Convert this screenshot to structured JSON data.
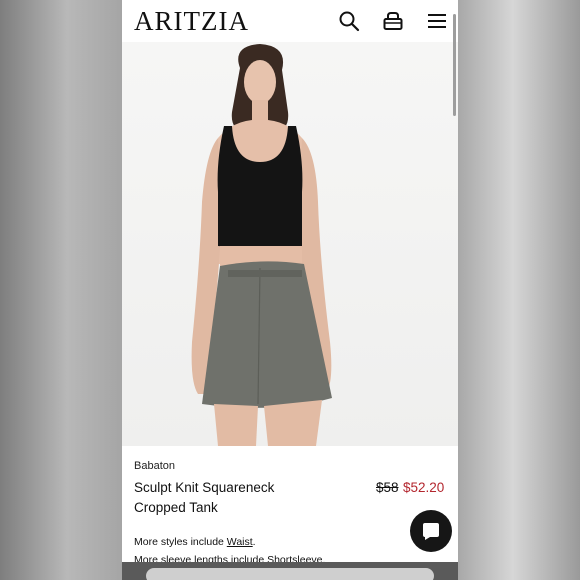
{
  "header": {
    "logo": "ARITZIA",
    "icons": [
      "search-icon",
      "bag-icon",
      "menu-icon"
    ]
  },
  "product": {
    "brand": "Babaton",
    "name": "Sculpt Knit Squareneck Cropped Tank",
    "original_price": "$58",
    "sale_price": "$52.20",
    "more_styles_prefix": "More styles include ",
    "more_styles_link": "Waist",
    "more_styles_suffix": ".",
    "more_sleeves": "More sleeve lengths include Shortsleeve."
  },
  "colors": {
    "sale_price": "#b3262e",
    "chat_button": "#161616",
    "tank": "#141414",
    "skirt": "#6f716b"
  }
}
